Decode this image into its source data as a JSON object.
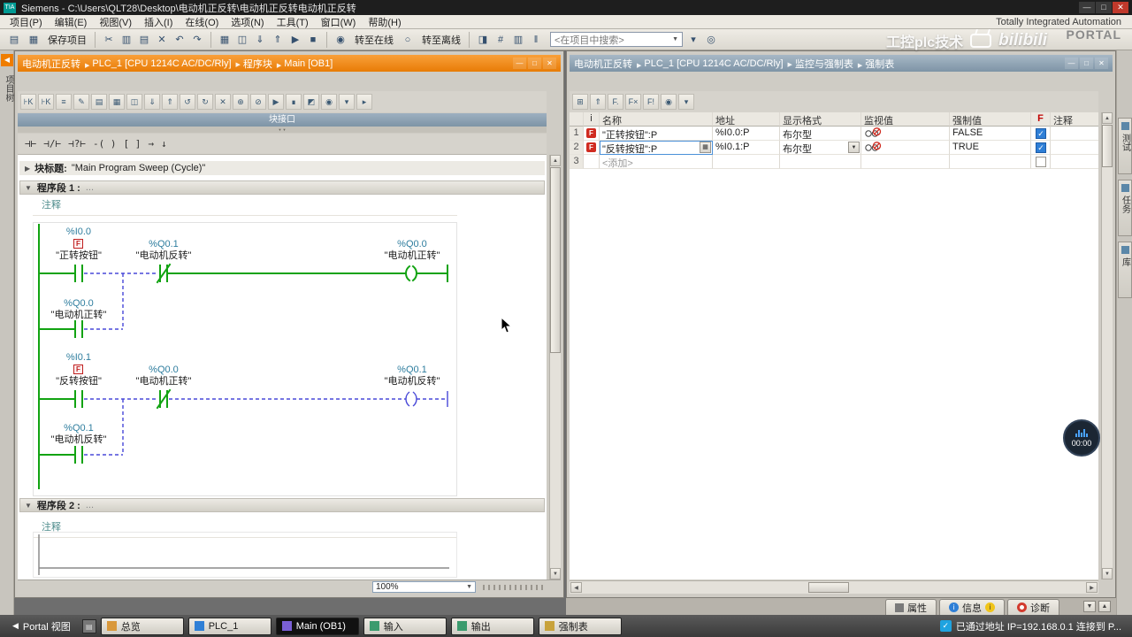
{
  "icons": {
    "dropdown": "▼",
    "check": "✓",
    "up": "▲",
    "down": "▼",
    "left": "◀",
    "right": "▶"
  },
  "titlebar": {
    "title": "Siemens - C:\\Users\\QLT28\\Desktop\\电动机正反转\\电动机正反转电动机正反转",
    "buttons": [
      "—",
      "□",
      "✕"
    ]
  },
  "menubar": {
    "items": [
      "项目(P)",
      "编辑(E)",
      "视图(V)",
      "插入(I)",
      "在线(O)",
      "选项(N)",
      "工具(T)",
      "窗口(W)",
      "帮助(H)"
    ]
  },
  "brand": {
    "line1": "Totally Integrated Automation",
    "line2": "PORTAL"
  },
  "toolbar": {
    "icons_a": [
      "▤"
    ],
    "save_label": "保存项目",
    "save_icon": "▦",
    "icons_b": [
      "✂",
      "▥",
      "▤",
      "✕",
      "↶",
      "↷"
    ],
    "icons_c": [
      "▦",
      "◫",
      "⇓",
      "⇑",
      "▶",
      "■"
    ],
    "go_online_icon": "◉",
    "go_online": "转至在线",
    "go_offline_icon": "○",
    "go_offline": "转至离线",
    "icons_d": [
      "◨",
      "#",
      "▥",
      "‖"
    ],
    "search_placeholder": "<在项目中搜索>",
    "icons_e": [
      "▾",
      "◎"
    ]
  },
  "watermark": {
    "text": "工控plc技术",
    "logo": "bilibili"
  },
  "left_strip": {
    "expand": "◀",
    "label": "项目树"
  },
  "editor": {
    "breadcrumb": [
      "电动机正反转",
      "PLC_1 [CPU 1214C AC/DC/Rly]",
      "程序块",
      "Main [OB1]"
    ],
    "window_buttons": [
      "—",
      "□",
      "✕"
    ],
    "toolbar_icons": [
      "⊦K",
      "⊦K",
      "≡",
      "✎",
      "▤",
      "▦",
      "◫",
      "⇓",
      "⇑",
      "↺",
      "↻",
      "✕",
      "⊕",
      "⊘",
      "▶",
      "∎",
      "◩",
      "◉",
      "▾",
      "▸"
    ],
    "interface_label": "块接口",
    "favorites": [
      "⊣⊢",
      "⊣/⊢",
      "⊣?⊢",
      "-( )",
      "[ ]",
      "→",
      "↓"
    ],
    "expand_icon": "▶",
    "collapse_icon": "▼",
    "block_title_label": "块标题:",
    "block_title_value": "\"Main Program Sweep (Cycle)\"",
    "network1_label": "程序段 1 :",
    "network2_label": "程序段 2 :",
    "dots": "...",
    "comment": "注释",
    "zoom": "100%",
    "ladder": {
      "c1_addr": "%I0.0",
      "c1_force": "F",
      "c1_name": "\"正转按钮\"",
      "c2_addr": "%Q0.1",
      "c2_name": "\"电动机反转\"",
      "coil1_addr": "%Q0.0",
      "coil1_name": "\"电动机正转\"",
      "b1_addr": "%Q0.0",
      "b1_name": "\"电动机正转\"",
      "c3_addr": "%I0.1",
      "c3_force": "F",
      "c3_name": "\"反转按钮\"",
      "c4_addr": "%Q0.0",
      "c4_name": "\"电动机正转\"",
      "coil2_addr": "%Q0.1",
      "coil2_name": "\"电动机反转\"",
      "b2_addr": "%Q0.1",
      "b2_name": "\"电动机反转\""
    }
  },
  "force_table": {
    "breadcrumb": [
      "电动机正反转",
      "PLC_1 [CPU 1214C AC/DC/Rly]",
      "监控与强制表",
      "强制表"
    ],
    "window_buttons": [
      "—",
      "□",
      "✕"
    ],
    "toolbar_icons": [
      "⊞",
      "⇑",
      "F.",
      "F×",
      "F!",
      "◉",
      "▾"
    ],
    "headers": {
      "i": "i",
      "name": "名称",
      "address": "地址",
      "format": "显示格式",
      "monitor": "监视值",
      "force": "强制值",
      "f": "F",
      "comment": "注释"
    },
    "rows": [
      {
        "num": "1",
        "name": "\"正转按钮\":P",
        "address": "%I0.0:P",
        "format": "布尔型",
        "force_value": "FALSE"
      },
      {
        "num": "2",
        "name": "\"反转按钮\":P",
        "address": "%I0.1:P",
        "format": "布尔型",
        "force_value": "TRUE"
      },
      {
        "num": "3",
        "name": "<添加>"
      }
    ]
  },
  "right_strip": {
    "tabs": [
      "测试",
      "任务",
      "库"
    ]
  },
  "inspector": {
    "tabs": [
      "属性",
      "信息",
      "诊断"
    ],
    "info_glyph": "i"
  },
  "taskbar": {
    "portal_icon": "◀",
    "portal": "Portal 视图",
    "buttons": [
      "总览",
      "PLC_1",
      "Main (OB1)",
      "输入",
      "输出",
      "强制表"
    ],
    "status": "已通过地址 IP=192.168.0.1 连接到 P..."
  },
  "overlay": {
    "time": "00:00"
  }
}
